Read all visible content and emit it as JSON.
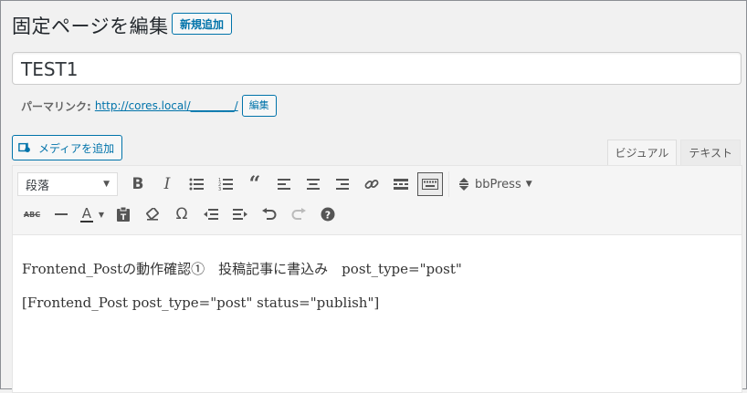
{
  "header": {
    "title": "固定ページを編集",
    "add_new_label": "新規追加"
  },
  "post": {
    "title_value": "TEST1"
  },
  "permalink": {
    "label": "パーマリンク:",
    "url": "http://cores.local/________/",
    "edit_label": "編集"
  },
  "media": {
    "add_media_label": "メディアを追加"
  },
  "tabs": [
    {
      "label": "ビジュアル",
      "active": true
    },
    {
      "label": "テキスト",
      "active": false
    }
  ],
  "toolbar": {
    "format_select": "段落",
    "bbpress_label": "bbPress",
    "row1_icons": [
      "bold-icon",
      "italic-icon",
      "bullet-list-icon",
      "numbered-list-icon",
      "blockquote-icon",
      "align-left-icon",
      "align-center-icon",
      "align-right-icon",
      "link-icon",
      "read-more-icon",
      "toolbar-toggle-icon",
      "bbpress-icon"
    ],
    "row2_icons": [
      "strikethrough-icon",
      "horizontal-line-icon",
      "text-color-icon",
      "paste-text-icon",
      "clear-formatting-icon",
      "special-character-icon",
      "outdent-icon",
      "indent-icon",
      "undo-icon",
      "redo-icon",
      "help-icon"
    ]
  },
  "editor": {
    "paragraphs": [
      "Frontend_Postの動作確認①　投稿記事に書込み　post_type=\"post\"",
      "[Frontend_Post post_type=\"post\" status=\"publish\"]"
    ]
  },
  "colors": {
    "accent": "#0073aa",
    "background": "#f1f1f1",
    "toolbar_bg": "#f5f5f5"
  }
}
